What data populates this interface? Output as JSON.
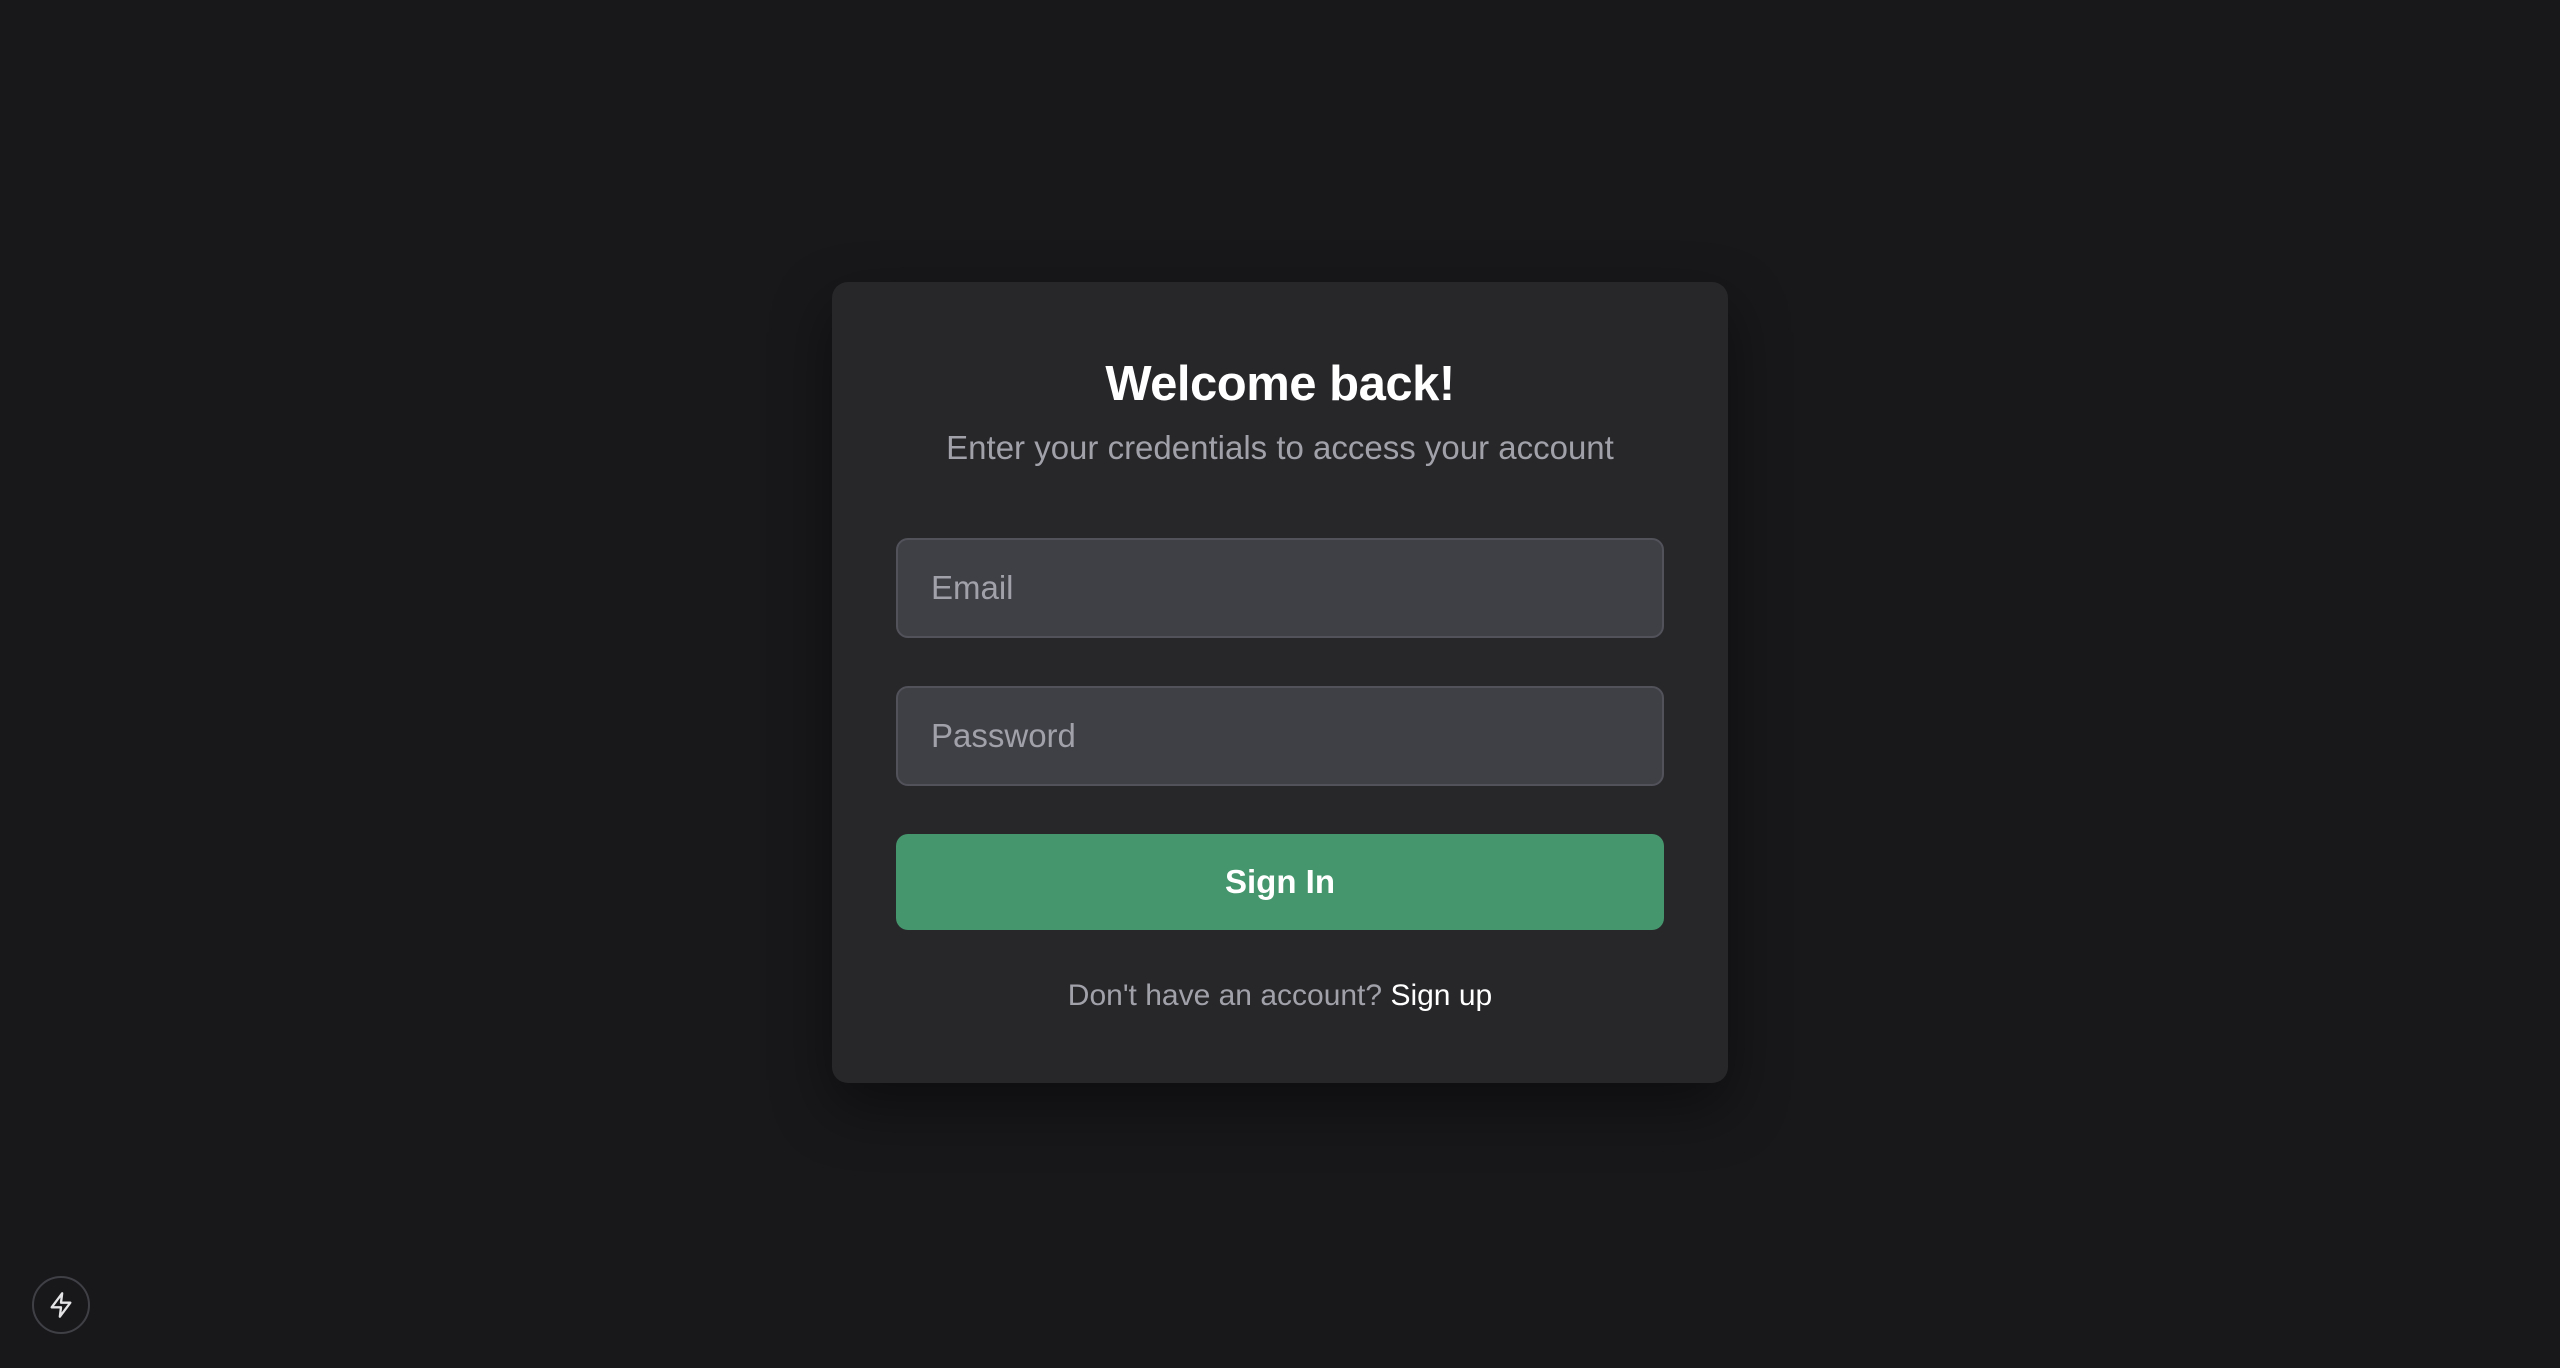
{
  "login_card": {
    "title": "Welcome back!",
    "subtitle": "Enter your credentials to access your account",
    "email_placeholder": "Email",
    "password_placeholder": "Password",
    "submit_label": "Sign In",
    "signup_prompt": "Don't have an account?",
    "signup_link": "Sign up"
  },
  "floating_button": {
    "icon": "lightning-bolt-icon"
  },
  "colors": {
    "background": "#18181b",
    "card": "#27272a",
    "input": "#3f3f46",
    "accent_green": "#46966d",
    "muted_text": "#a1a1aa"
  }
}
